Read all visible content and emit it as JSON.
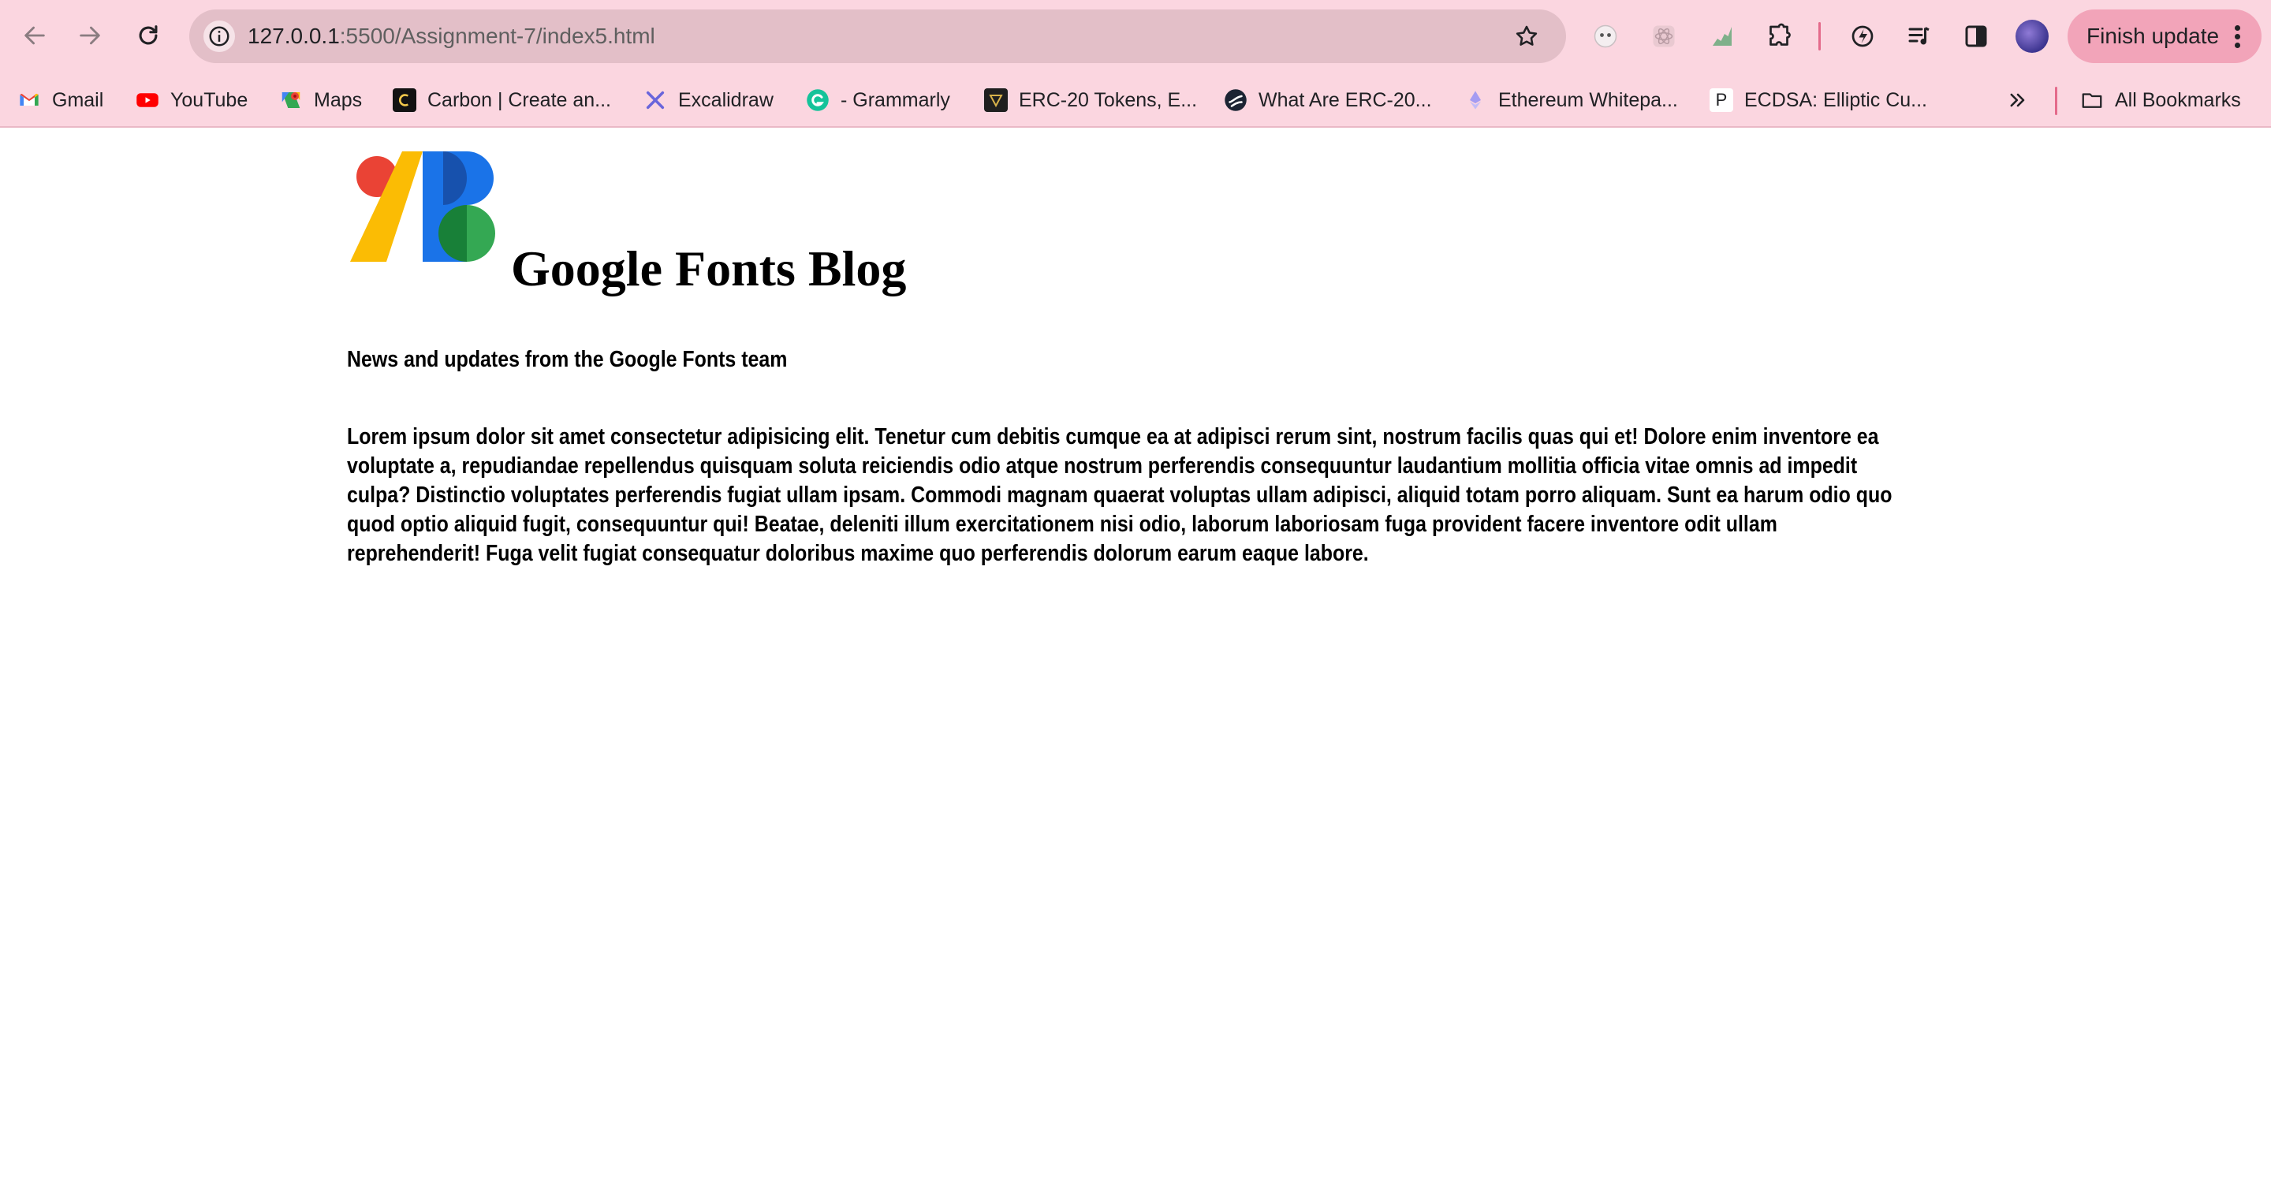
{
  "browser": {
    "url_host": "127.0.0.1",
    "url_path": ":5500/Assignment-7/index5.html",
    "finish_update_label": "Finish update",
    "all_bookmarks_label": "All Bookmarks"
  },
  "bookmarks": [
    {
      "label": "Gmail",
      "icon": "gmail-icon"
    },
    {
      "label": "YouTube",
      "icon": "youtube-icon"
    },
    {
      "label": "Maps",
      "icon": "maps-icon"
    },
    {
      "label": "Carbon | Create an...",
      "icon": "carbon-icon"
    },
    {
      "label": "Excalidraw",
      "icon": "excalidraw-icon"
    },
    {
      "label": "- Grammarly",
      "icon": "grammarly-icon"
    },
    {
      "label": "ERC-20 Tokens, E...",
      "icon": "erc20-icon"
    },
    {
      "label": "What Are ERC-20...",
      "icon": "erc20-article-icon"
    },
    {
      "label": "Ethereum Whitepa...",
      "icon": "ethereum-icon"
    },
    {
      "label": "ECDSA: Elliptic Cu...",
      "icon": "ecdsa-icon"
    }
  ],
  "page": {
    "title": "Google Fonts Blog",
    "tagline": "News and updates from the Google Fonts team",
    "body": "Lorem ipsum dolor sit amet consectetur adipisicing elit. Tenetur cum debitis cumque ea at adipisci rerum sint, nostrum facilis quas qui et! Dolore enim inventore ea voluptate a, repudiandae repellendus quisquam soluta reiciendis odio atque nostrum perferendis consequuntur laudantium mollitia officia vitae omnis ad impedit culpa? Distinctio voluptates perferendis fugiat ullam ipsam. Commodi magnam quaerat voluptas ullam adipisci, aliquid totam porro aliquam. Sunt ea harum odio quo quod optio aliquid fugit, consequuntur qui! Beatae, deleniti illum exercitationem nisi odio, laborum laboriosam fuga provident facere inventore odit ullam reprehenderit! Fuga velit fugiat consequatur doloribus maxime quo perferendis dolorum earum eaque labore."
  },
  "colors": {
    "chrome_bg": "#fbd6e0",
    "omnibox_bg": "#e3bfc8",
    "finish_update_bg": "#f2a4b9",
    "logo_red": "#ea4335",
    "logo_yellow": "#fbbc04",
    "logo_blue": "#1a73e8",
    "logo_green": "#34a853"
  }
}
